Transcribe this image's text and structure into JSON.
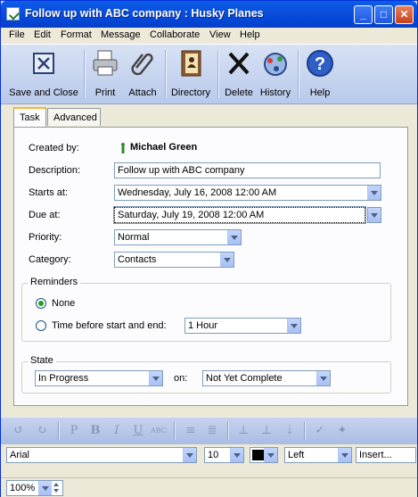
{
  "window": {
    "title": "Follow up with ABC company : Husky Planes"
  },
  "menu": [
    "File",
    "Edit",
    "Format",
    "Message",
    "Collaborate",
    "View",
    "Help"
  ],
  "toolbar": {
    "save_close": "Save and Close",
    "print": "Print",
    "attach": "Attach",
    "directory": "Directory",
    "delete": "Delete",
    "history": "History",
    "help": "Help"
  },
  "tabs": [
    "Task",
    "Advanced"
  ],
  "form": {
    "created_by_label": "Created by:",
    "created_by_value": "Michael Green",
    "description_label": "Description:",
    "description_value": "Follow up with ABC company",
    "starts_label": "Starts at:",
    "starts_value": "Wednesday, July 16, 2008 12:00 AM",
    "due_label": "Due at:",
    "due_value": "Saturday, July 19, 2008 12:00 AM",
    "priority_label": "Priority:",
    "priority_value": "Normal",
    "category_label": "Category:",
    "category_value": "Contacts"
  },
  "reminders": {
    "title": "Reminders",
    "none_label": "None",
    "before_label": "Time before start and end:",
    "before_value": "1 Hour",
    "selected": "None"
  },
  "state": {
    "title": "State",
    "status_value": "In Progress",
    "on_label": "on:",
    "completion_value": "Not Yet Complete"
  },
  "format": {
    "font": "Arial",
    "size": "10",
    "color": "#000000",
    "align": "Left",
    "insert": "Insert..."
  },
  "zoom": "100%",
  "colors": {
    "accent": "#0A5EE8",
    "tab_highlight": "#F5B73A"
  }
}
